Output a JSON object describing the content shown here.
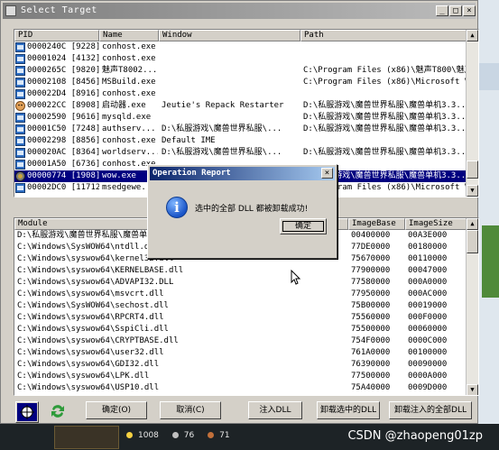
{
  "window": {
    "title": "Select Target",
    "controls": {
      "minimize": "_",
      "maximize": "□",
      "close": "×"
    }
  },
  "process_list": {
    "headers": [
      "PID",
      "Name",
      "Window",
      "Path"
    ],
    "rows": [
      {
        "pid": "0000240C [9228]",
        "name": "conhost.exe",
        "window": "",
        "path": "",
        "icon": "app-icon"
      },
      {
        "pid": "00001024 [4132]",
        "name": "conhost.exe",
        "window": "",
        "path": "",
        "icon": "app-icon"
      },
      {
        "pid": "0000265C [9820]",
        "name": "魅声T8002...",
        "window": "",
        "path": "C:\\Program Files (x86)\\魅声T800\\魅声...",
        "icon": "app-icon"
      },
      {
        "pid": "00002108 [8456]",
        "name": "MSBuild.exe",
        "window": "",
        "path": "C:\\Program Files (x86)\\Microsoft Vis...",
        "icon": "app-icon"
      },
      {
        "pid": "000022D4 [8916]",
        "name": "conhost.exe",
        "window": "",
        "path": "",
        "icon": "app-icon"
      },
      {
        "pid": "000022CC [8908]",
        "name": "启动器.exe",
        "window": "Jeutie's Repack Restarter",
        "path": "D:\\私服游戏\\魔兽世界私服\\魔兽单机3.3...",
        "icon": "face-icon"
      },
      {
        "pid": "00002590 [9616]",
        "name": "mysqld.exe",
        "window": "",
        "path": "D:\\私服游戏\\魔兽世界私服\\魔兽单机3.3...",
        "icon": "app-icon"
      },
      {
        "pid": "00001C50 [7248]",
        "name": "authserv...",
        "window": "D:\\私服游戏\\魔兽世界私服\\...",
        "path": "D:\\私服游戏\\魔兽世界私服\\魔兽单机3.3...",
        "icon": "app-icon"
      },
      {
        "pid": "00002298 [8856]",
        "name": "conhost.exe",
        "window": "Default IME",
        "path": "",
        "icon": "app-icon"
      },
      {
        "pid": "000020AC [8364]",
        "name": "worldserv...",
        "window": "D:\\私服游戏\\魔兽世界私服\\...",
        "path": "D:\\私服游戏\\魔兽世界私服\\魔兽单机3.3...",
        "icon": "app-icon"
      },
      {
        "pid": "00001A50 [6736]",
        "name": "conhost.exe",
        "window": "",
        "path": "",
        "icon": "app-icon"
      },
      {
        "pid": "00000774 [1908]",
        "name": "wow.exe",
        "window": "",
        "path": "D:\\私服游戏\\魔兽世界私服\\魔兽单机3.3...",
        "icon": "wow-icon",
        "selected": true
      },
      {
        "pid": "00002DC0 [11712]",
        "name": "msedgewe...",
        "window": "",
        "path": "C:\\Program Files (x86)\\Microsoft Vis...",
        "icon": "app-icon"
      }
    ]
  },
  "module_list": {
    "headers": [
      "Module",
      "ImageBase",
      "ImageSize"
    ],
    "rows": [
      {
        "module": "D:\\私服游戏\\魔兽世界私服\\魔兽单机3.3.5\\wow.exe",
        "base": "00400000",
        "size": "00A3E000"
      },
      {
        "module": "C:\\Windows\\SysWOW64\\ntdll.dll",
        "base": "77DE0000",
        "size": "00180000"
      },
      {
        "module": "C:\\Windows\\syswow64\\kernel32.dll",
        "base": "75670000",
        "size": "00110000"
      },
      {
        "module": "C:\\Windows\\syswow64\\KERNELBASE.dll",
        "base": "77900000",
        "size": "00047000"
      },
      {
        "module": "C:\\Windows\\syswow64\\ADVAPI32.DLL",
        "base": "77580000",
        "size": "000A0000"
      },
      {
        "module": "C:\\Windows\\syswow64\\msvcrt.dll",
        "base": "77950000",
        "size": "000AC000"
      },
      {
        "module": "C:\\Windows\\SysWOW64\\sechost.dll",
        "base": "75B00000",
        "size": "00019000"
      },
      {
        "module": "C:\\Windows\\syswow64\\RPCRT4.dll",
        "base": "75560000",
        "size": "000F0000"
      },
      {
        "module": "C:\\Windows\\syswow64\\SspiCli.dll",
        "base": "75500000",
        "size": "00060000"
      },
      {
        "module": "C:\\Windows\\syswow64\\CRYPTBASE.dll",
        "base": "754F0000",
        "size": "0000C000"
      },
      {
        "module": "C:\\Windows\\syswow64\\user32.dll",
        "base": "761A0000",
        "size": "00100000"
      },
      {
        "module": "C:\\Windows\\syswow64\\GDI32.dll",
        "base": "76390000",
        "size": "00090000"
      },
      {
        "module": "C:\\Windows\\syswow64\\LPK.dll",
        "base": "77500000",
        "size": "0000A000"
      },
      {
        "module": "C:\\Windows\\syswow64\\USP10.dll",
        "base": "75A40000",
        "size": "0009D000"
      }
    ]
  },
  "buttons": {
    "ok": "确定(O)",
    "cancel": "取消(C)",
    "inject": "注入DLL",
    "unload_selected": "卸载选中的DLL",
    "unload_all": "卸载注入的全部DLL"
  },
  "dialog": {
    "title": "Operation Report",
    "message": "选中的全部 DLL 都被卸载成功!",
    "ok": "确定",
    "close": "×"
  },
  "taskbar": {
    "stat1": "1008",
    "stat2": "76",
    "stat3": "71",
    "credit": "CSDN @zhaopeng01zp"
  }
}
